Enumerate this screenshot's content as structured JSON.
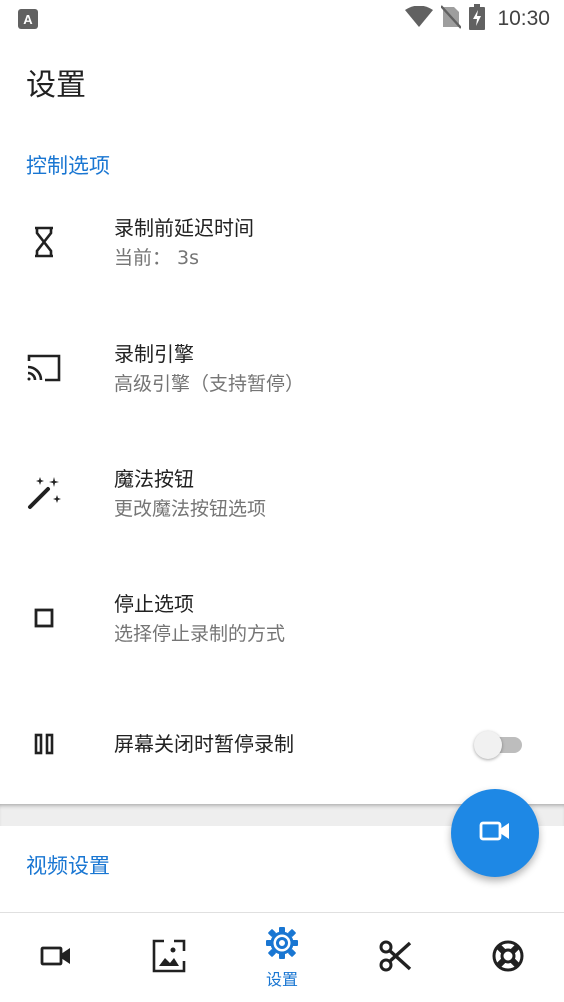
{
  "status_bar": {
    "app_badge": "A",
    "time": "10:30"
  },
  "page": {
    "title": "设置"
  },
  "sections": {
    "control": {
      "header": "控制选项"
    },
    "video": {
      "header": "视频设置"
    }
  },
  "settings": [
    {
      "icon": "hourglass-icon",
      "title": "录制前延迟时间",
      "subtitle": "当前： 3s"
    },
    {
      "icon": "cast-icon",
      "title": "录制引擎",
      "subtitle": "高级引擎（支持暂停）"
    },
    {
      "icon": "magic-wand-icon",
      "title": "魔法按钮",
      "subtitle": "更改魔法按钮选项"
    },
    {
      "icon": "stop-icon",
      "title": "停止选项",
      "subtitle": "选择停止录制的方式"
    },
    {
      "icon": "pause-icon",
      "title": "屏幕关闭时暂停录制",
      "toggle_on": false
    }
  ],
  "fab": {
    "icon": "videocam-icon"
  },
  "bottom_nav": {
    "items": [
      {
        "icon": "videocam-icon",
        "label": ""
      },
      {
        "icon": "gallery-icon",
        "label": ""
      },
      {
        "icon": "settings-gear-icon",
        "label": "设置",
        "active": true
      },
      {
        "icon": "scissors-icon",
        "label": ""
      },
      {
        "icon": "support-ring-icon",
        "label": ""
      }
    ]
  },
  "colors": {
    "accent": "#1976D2",
    "fab": "#1E88E5",
    "text_primary": "#212121",
    "text_secondary": "#757575"
  }
}
